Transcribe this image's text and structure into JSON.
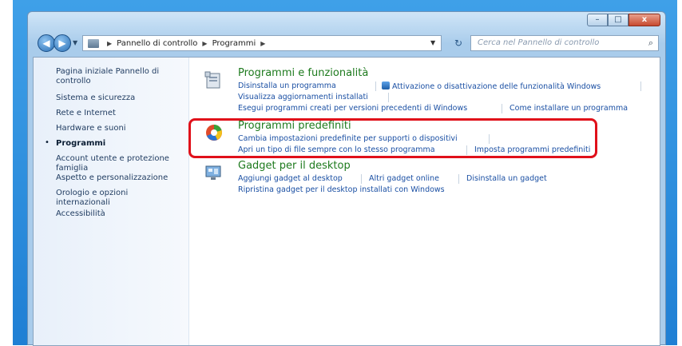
{
  "window": {
    "caption": {
      "minimize": "–",
      "maximize": "□",
      "close": "x"
    }
  },
  "address": {
    "back": "◀",
    "forward": "▶",
    "crumbs": [
      "Pannello di controllo",
      "Programmi"
    ],
    "search_placeholder": "Cerca nel Pannello di controllo"
  },
  "sidebar": {
    "items": [
      {
        "label": "Pagina iniziale Pannello di controllo",
        "active": false
      },
      {
        "label": "Sistema e sicurezza",
        "active": false
      },
      {
        "label": "Rete e Internet",
        "active": false
      },
      {
        "label": "Hardware e suoni",
        "active": false
      },
      {
        "label": "Programmi",
        "active": true
      },
      {
        "label": "Account utente e protezione famiglia",
        "active": false
      },
      {
        "label": "Aspetto e personalizzazione",
        "active": false
      },
      {
        "label": "Orologio e opzioni internazionali",
        "active": false
      },
      {
        "label": "Accessibilità",
        "active": false
      }
    ]
  },
  "categories": [
    {
      "title": "Programmi e funzionalità",
      "icon": "programs-features-icon",
      "links": [
        "Disinstalla un programma",
        "Attivazione o disattivazione delle funzionalità Windows",
        "Visualizza aggiornamenti installati",
        "Esegui programmi creati per versioni precedenti di Windows",
        "Come installare un programma"
      ]
    },
    {
      "title": "Programmi predefiniti",
      "icon": "default-programs-icon",
      "links": [
        "Cambia impostazioni predefinite per supporti o dispositivi",
        "Apri un tipo di file sempre con lo stesso programma",
        "Imposta programmi predefiniti"
      ]
    },
    {
      "title": "Gadget per il desktop",
      "icon": "desktop-gadgets-icon",
      "links": [
        "Aggiungi gadget al desktop",
        "Altri gadget online",
        "Disinstalla un gadget",
        "Ripristina gadget per il desktop installati con Windows"
      ]
    }
  ],
  "colors": {
    "highlight": "#e0101a",
    "link": "#1a4fa3",
    "category_title": "#1d7a1d"
  }
}
